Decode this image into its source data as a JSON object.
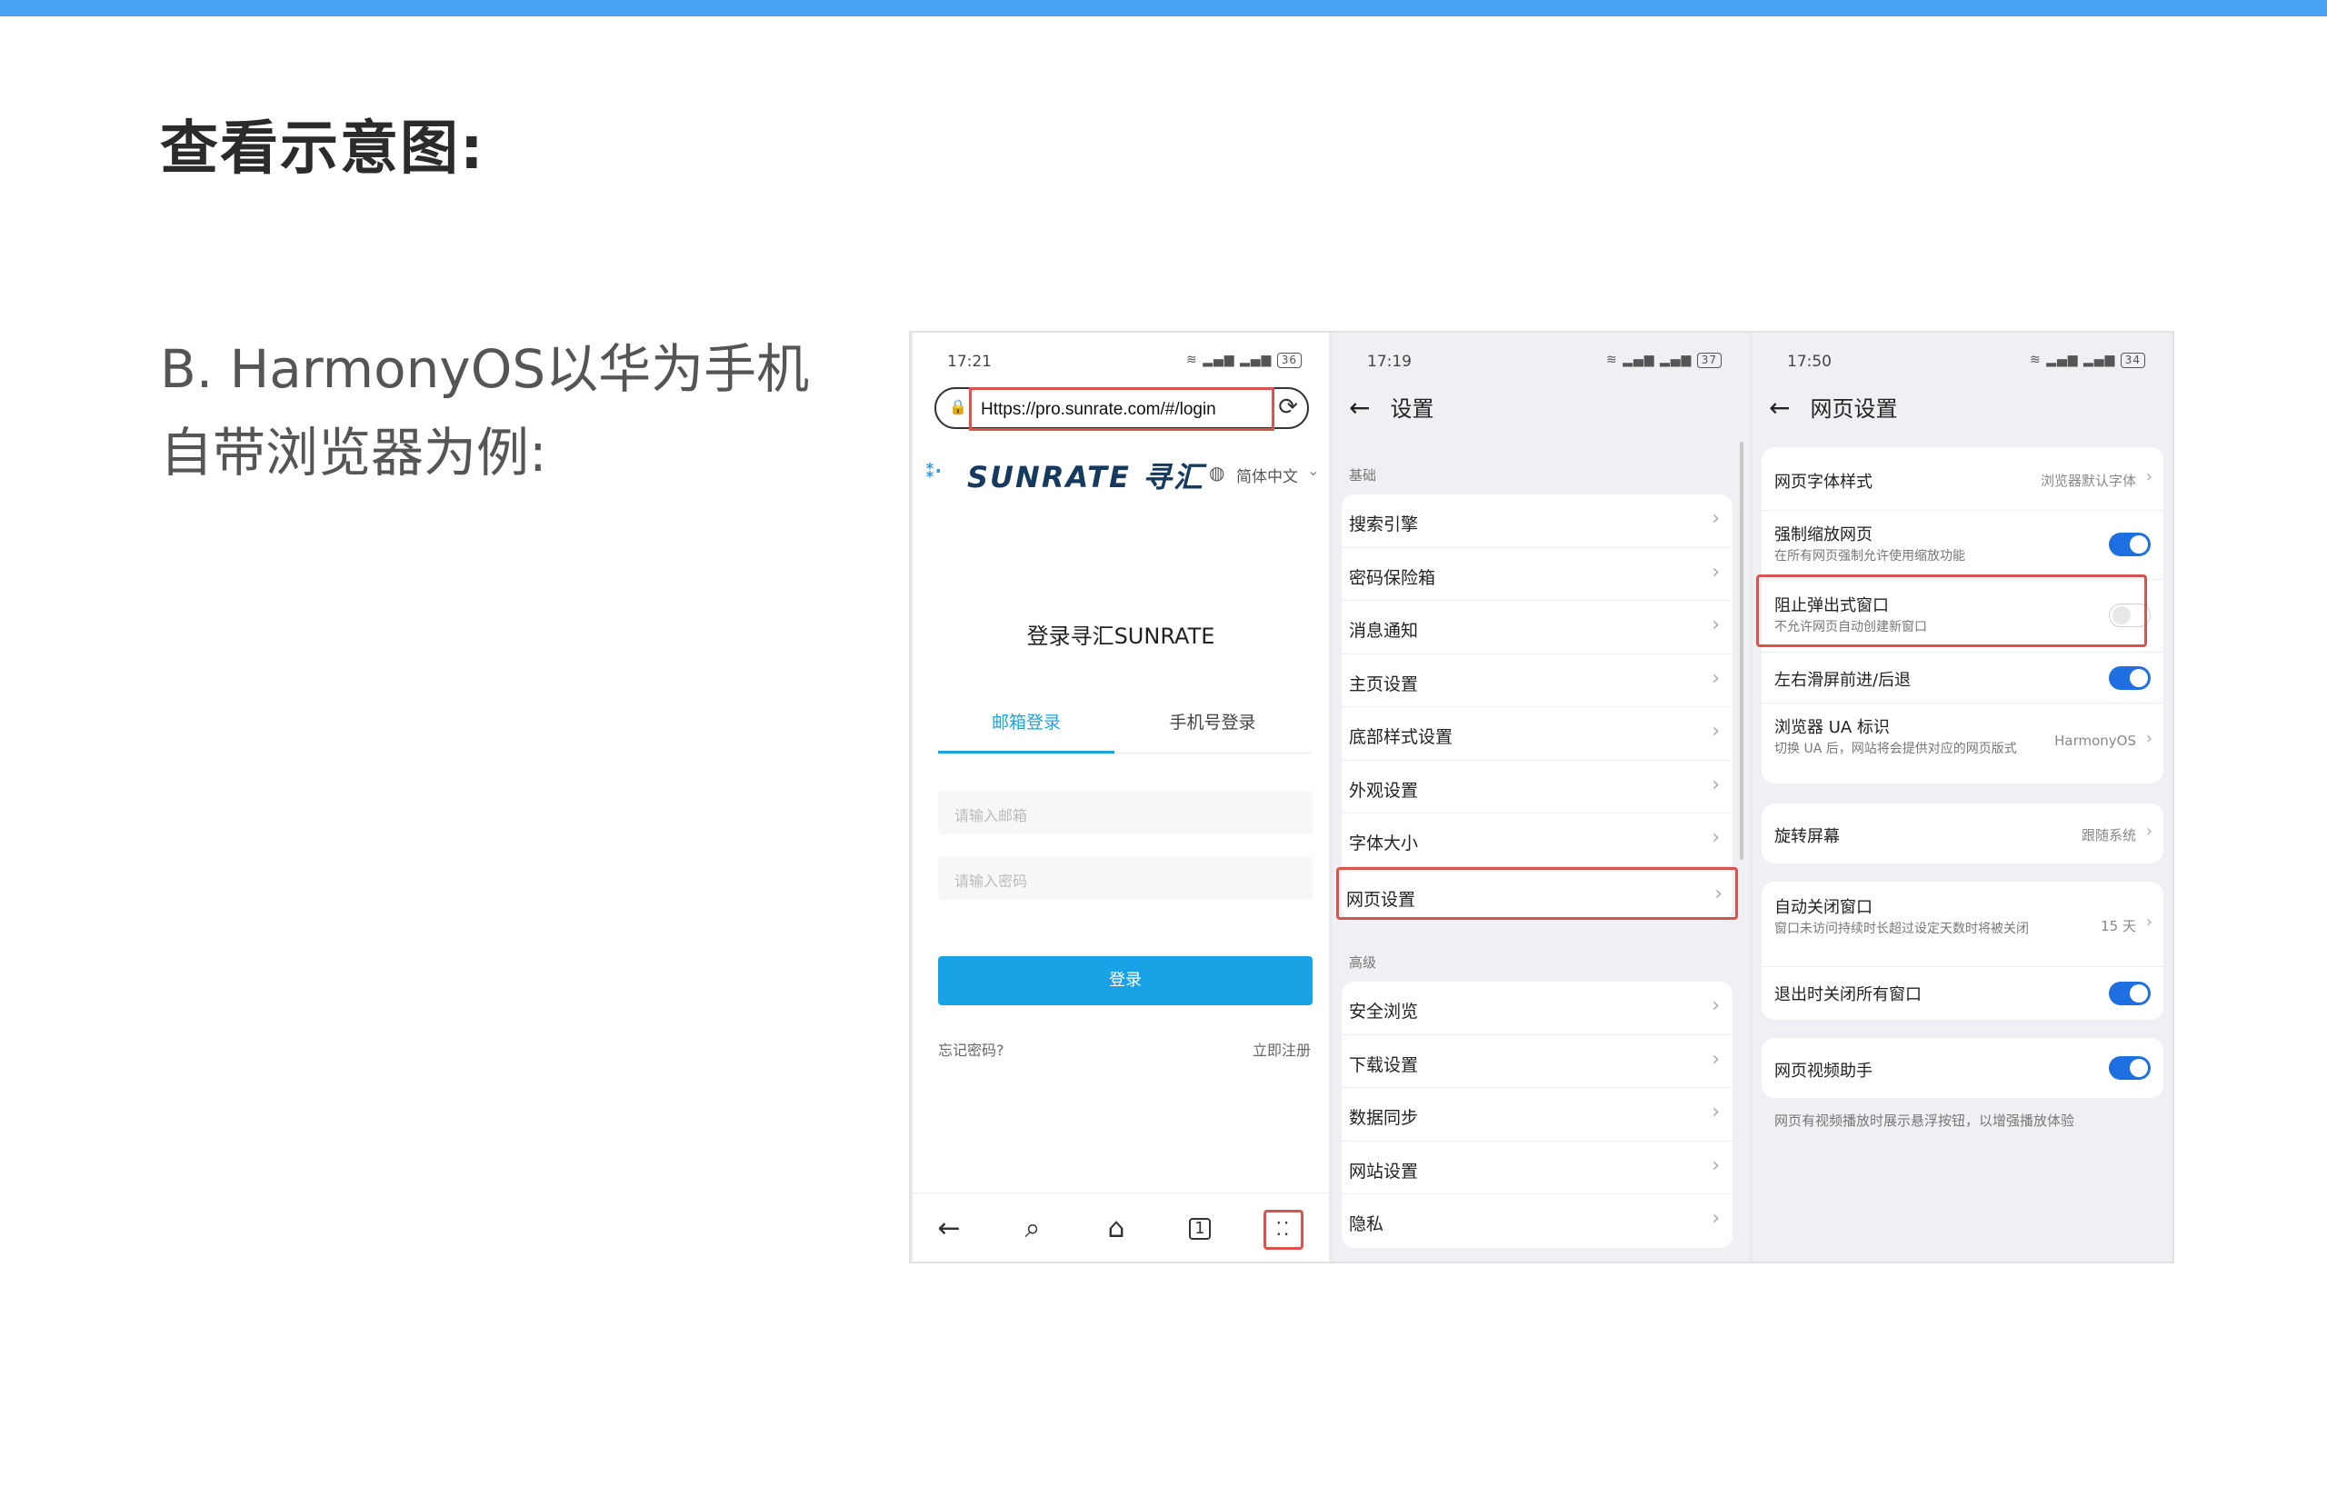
{
  "page": {
    "title": "查看示意图:",
    "description": "B. HarmonyOS以华为手机自带浏览器为例:",
    "accent_color": "#4aa3f5",
    "highlight_color": "#d9534f"
  },
  "phone1": {
    "time": "17:21",
    "battery": "36",
    "url": "Https://pro.sunrate.com/#/login",
    "brand": "SUNRATE 寻汇",
    "language": "简体中文",
    "login_title": "登录寻汇SUNRATE",
    "tab_email": "邮箱登录",
    "tab_phone": "手机号登录",
    "email_placeholder": "请输入邮箱",
    "password_placeholder": "请输入密码",
    "login_button": "登录",
    "forgot_password": "忘记密码?",
    "register": "立即注册",
    "nav_icons": [
      "back-icon",
      "search-icon",
      "home-icon",
      "tabs-icon",
      "more-icon"
    ],
    "tabs_count": "1"
  },
  "phone2": {
    "time": "17:19",
    "battery": "37",
    "title": "设置",
    "section_basic": "基础",
    "basic_items": [
      "搜索引擎",
      "密码保险箱",
      "消息通知",
      "主页设置",
      "底部样式设置",
      "外观设置",
      "字体大小",
      "网页设置"
    ],
    "section_advanced": "高级",
    "advanced_items": [
      "安全浏览",
      "下载设置",
      "数据同步",
      "网站设置",
      "隐私"
    ]
  },
  "phone3": {
    "time": "17:50",
    "battery": "34",
    "title": "网页设置",
    "font_style": {
      "title": "网页字体样式",
      "value": "浏览器默认字体"
    },
    "force_zoom": {
      "title": "强制缩放网页",
      "subtitle": "在所有网页强制允许使用缩放功能",
      "on": true
    },
    "block_popup": {
      "title": "阻止弹出式窗口",
      "subtitle": "不允许网页自动创建新窗口",
      "on": false
    },
    "swipe_nav": {
      "title": "左右滑屏前进/后退",
      "on": true
    },
    "ua": {
      "title": "浏览器 UA 标识",
      "subtitle": "切换 UA 后，网站将会提供对应的网页版式",
      "value": "HarmonyOS"
    },
    "rotate": {
      "title": "旋转屏幕",
      "value": "跟随系统"
    },
    "auto_close": {
      "title": "自动关闭窗口",
      "subtitle": "窗口未访问持续时长超过设定天数时将被关闭",
      "value": "15 天"
    },
    "close_on_exit": {
      "title": "退出时关闭所有窗口",
      "on": true
    },
    "video_helper": {
      "title": "网页视频助手",
      "on": true
    },
    "video_note": "网页有视频播放时展示悬浮按钮，以增强播放体验"
  }
}
